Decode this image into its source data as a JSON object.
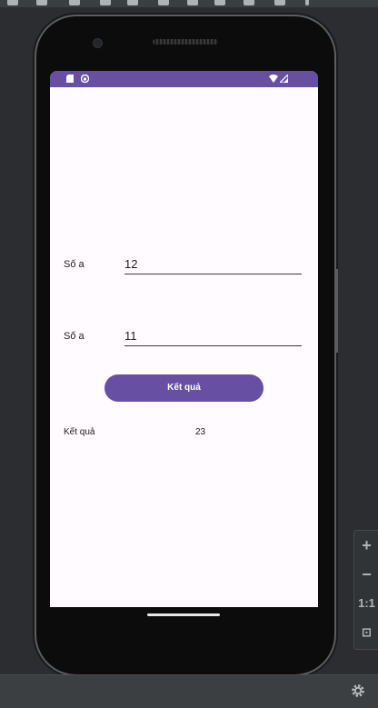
{
  "app": {
    "row1": {
      "label": "Số a",
      "value": "12"
    },
    "row2": {
      "label": "Số a",
      "value": "11"
    },
    "button_label": "Kết quả",
    "result_label": "Kết quả",
    "result_value": "23"
  },
  "zoom": {
    "zoom_in": "+",
    "zoom_out": "−",
    "actual_size": "1:1",
    "fit_screen": "⊡"
  },
  "colors": {
    "accent": "#6750a4",
    "screen_background": "#fffbfe",
    "ide_background": "#2b2d30"
  },
  "icons": {
    "status_left": [
      "sd-card-icon",
      "notification-icon"
    ],
    "status_right": [
      "wifi-icon",
      "signal-icon"
    ],
    "settings": "gear-icon"
  }
}
